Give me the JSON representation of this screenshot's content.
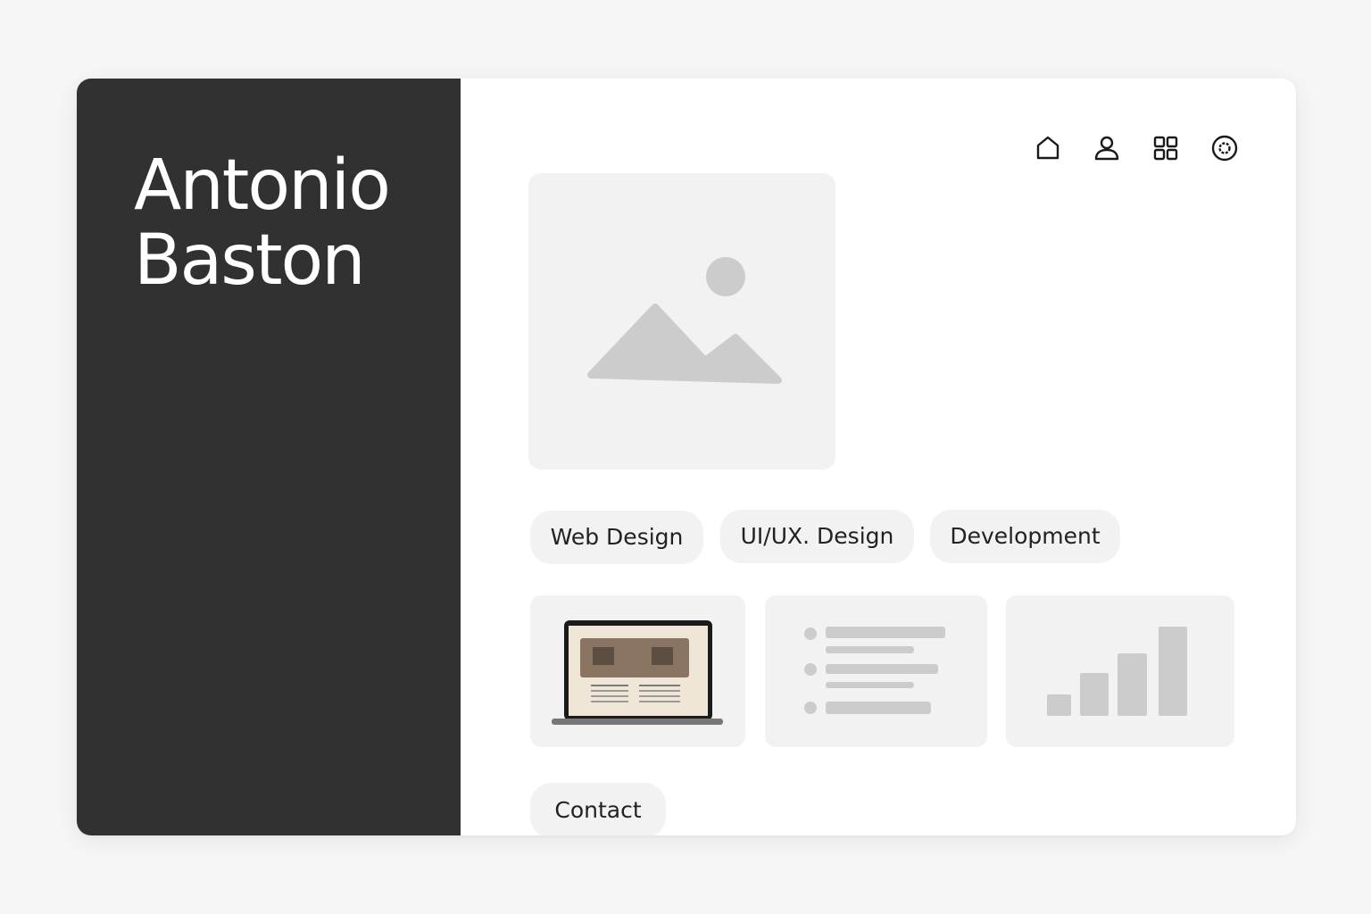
{
  "profile": {
    "first_name": "Antonio",
    "last_name": "Baston"
  },
  "nav": {
    "items": [
      {
        "icon": "home-icon"
      },
      {
        "icon": "user-icon"
      },
      {
        "icon": "grid-icon"
      },
      {
        "icon": "settings-icon"
      }
    ]
  },
  "hero": {
    "icon": "image-placeholder-icon"
  },
  "categories": [
    {
      "label": "Web Design"
    },
    {
      "label": "UI/UX. Design"
    },
    {
      "label": "Development"
    }
  ],
  "projects": [
    {
      "icon": "laptop-screenshot-icon"
    },
    {
      "icon": "list-icon"
    },
    {
      "icon": "bar-chart-icon"
    }
  ],
  "contact": {
    "label": "Contact"
  },
  "colors": {
    "background": "#f6f6f6",
    "sidebar": "#313131",
    "placeholder": "#f2f2f2",
    "placeholder_shape": "#cccccc",
    "text_dark": "#222222",
    "text_light": "#ffffff"
  }
}
